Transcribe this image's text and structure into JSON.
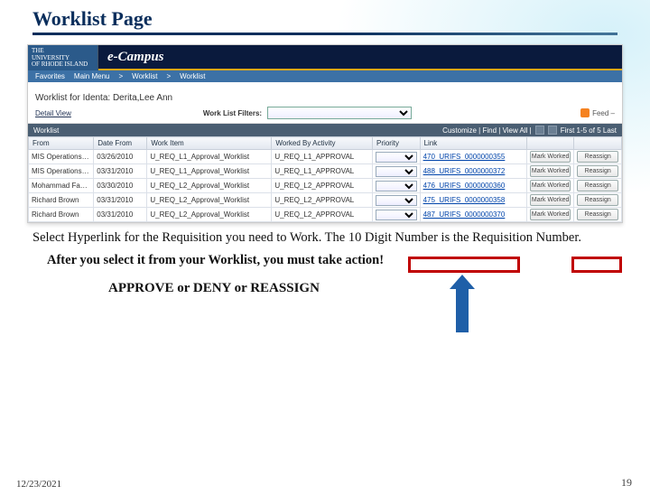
{
  "slide": {
    "title": "Worklist Page",
    "instruction1": "Select Hyperlink for the Requisition you need to Work. The 10 Digit Number is the Requisition Number.",
    "instruction2": "After you select it from your Worklist, you must take action!",
    "approve_line": "APPROVE or DENY or REASSIGN",
    "footer_date": "12/23/2021",
    "footer_page": "19"
  },
  "ui": {
    "uni_logo_line1": "THE",
    "uni_logo_line2": "UNIVERSITY",
    "uni_logo_line3": "OF RHODE ISLAND",
    "ecampus": "e-Campus",
    "menu": {
      "favorites": "Favorites",
      "main": "Main Menu",
      "sep": ">",
      "worklist": "Worklist",
      "worklist2": "Worklist"
    },
    "worklist_for": "Worklist for Identa: Derita,Lee Ann",
    "detail_view": "Detail View",
    "filter_label": "Work List Filters:",
    "feed_label": "Feed –",
    "grid_label": "Worklist",
    "grid_tools": "Customize | Find | View All |",
    "grid_nav": "First  1-5 of 5  Last",
    "columns": {
      "from": "From",
      "date": "Date From",
      "item": "Work Item",
      "activity": "Worked By Activity",
      "priority": "Priority",
      "link": "Link"
    },
    "buttons": {
      "mark_worked": "Mark Worked",
      "reassign": "Reassign"
    },
    "rows": [
      {
        "from": "MIS Operations Scheduler",
        "date": "03/26/2010",
        "item": "U_REQ_L1_Approval_Worklist",
        "activity": "U_REQ_L1_APPROVAL",
        "link": "470_URIFS_0000000355"
      },
      {
        "from": "MIS Operations Scheduler",
        "date": "03/31/2010",
        "item": "U_REQ_L1_Approval_Worklist",
        "activity": "U_REQ_L1_APPROVAL",
        "link": "488_URIFS_0000000372"
      },
      {
        "from": "Mohammad Faghri",
        "date": "03/30/2010",
        "item": "U_REQ_L2_Approval_Worklist",
        "activity": "U_REQ_L2_APPROVAL",
        "link": "476_URIFS_0000000360"
      },
      {
        "from": "Richard Brown",
        "date": "03/31/2010",
        "item": "U_REQ_L2_Approval_Worklist",
        "activity": "U_REQ_L2_APPROVAL",
        "link": "475_URIFS_0000000358"
      },
      {
        "from": "Richard Brown",
        "date": "03/31/2010",
        "item": "U_REQ_L2_Approval_Worklist",
        "activity": "U_REQ_L2_APPROVAL",
        "link": "487_URIFS_0000000370"
      }
    ]
  }
}
